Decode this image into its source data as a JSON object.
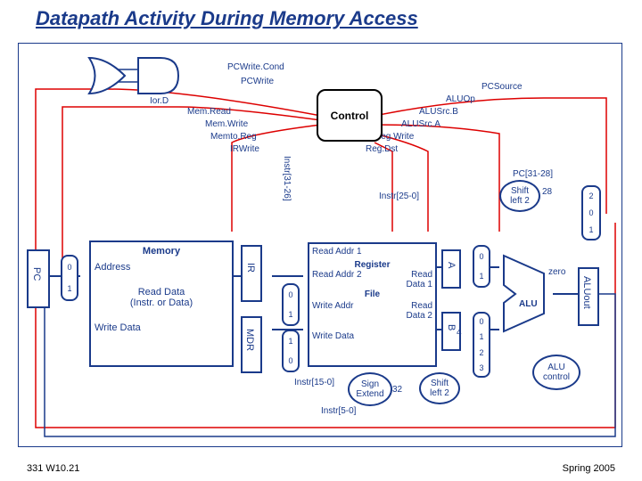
{
  "title": "Datapath Activity During Memory Access",
  "footer": {
    "left": "331 W10.21",
    "right": "Spring 2005"
  },
  "signals": {
    "pcwritecond": "PCWrite.Cond",
    "pcwrite": "PCWrite",
    "iord": "Ior.D",
    "memread": "Mem.Read",
    "memwrite": "Mem.Write",
    "memtoreg": "Memto.Reg",
    "irwrite": "IRWrite",
    "pcsource": "PCSource",
    "aluop": "ALUOp",
    "alusrcb": "ALUSrc.B",
    "alusrca": "ALUSrc.A",
    "regwrite": "Reg.Write",
    "regdst": "Reg.Dst"
  },
  "blocks": {
    "control": "Control",
    "pc": "PC",
    "memory": "Memory",
    "address": "Address",
    "readdata": "Read Data\n(Instr. or Data)",
    "writedata_mem": "Write Data",
    "ir": "IR",
    "mdr": "MDR",
    "register": "Register",
    "file": "File",
    "readaddr1": "Read Addr 1",
    "readaddr2": "Read Addr 2",
    "writeaddr": "Write Addr",
    "writedata_reg": "Write Data",
    "readdata1": "Read\nData 1",
    "readdata2": "Read\nData 2",
    "a": "A",
    "b": "B",
    "alu": "ALU",
    "zero": "zero",
    "aluout": "ALUout",
    "alucontrol": "ALU\ncontrol",
    "signextend": "Sign\nExtend",
    "shiftleft2a": "Shift\nleft 2",
    "shiftleft2b": "Shift\nleft 2"
  },
  "buses": {
    "instr3126": "Instr[31-26]",
    "instr250": "Instr[25-0]",
    "instr150": "Instr[15-0]",
    "instr50": "Instr[5-0]",
    "pc3128": "PC[31-28]",
    "ext32": "32",
    "cat28": "28",
    "four": "4"
  },
  "mux": {
    "n0": "0",
    "n1": "1",
    "n2": "2",
    "n3": "3"
  }
}
